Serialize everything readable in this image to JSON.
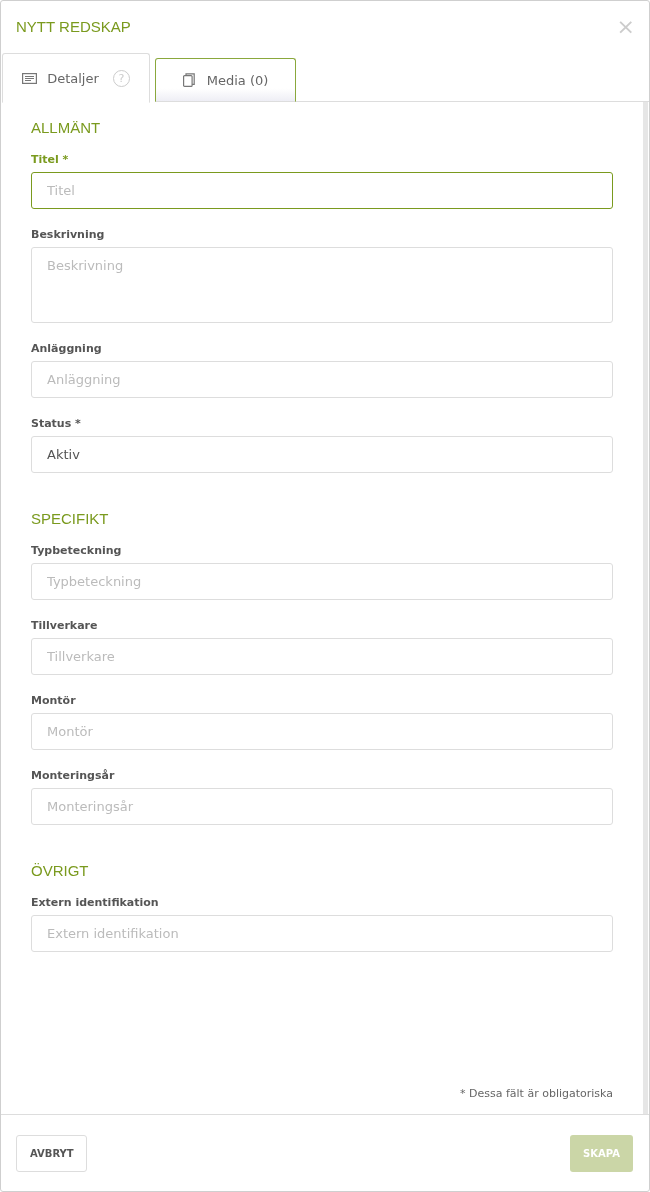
{
  "dialog": {
    "title": "NYTT REDSKAP",
    "close": "×"
  },
  "tabs": [
    {
      "label": "Detaljer",
      "kind": "details",
      "help": "?",
      "selected": true
    },
    {
      "label": "Media (0)",
      "kind": "media",
      "selected": false
    }
  ],
  "sections": [
    {
      "title": "ALLMÄNT",
      "fields": [
        {
          "label": "Titel *",
          "kind": "input",
          "placeholder": "Titel",
          "focused": true
        },
        {
          "label": "Beskrivning",
          "kind": "textarea",
          "placeholder": "Beskrivning",
          "focused": false
        },
        {
          "label": "Anläggning",
          "kind": "input",
          "placeholder": "Anläggning",
          "focused": false
        },
        {
          "label": "Status *",
          "kind": "input",
          "value": "Aktiv",
          "focused": false
        }
      ]
    },
    {
      "title": "SPECIFIKT",
      "fields": [
        {
          "label": "Typbeteckning",
          "kind": "input",
          "placeholder": "Typbeteckning",
          "focused": false
        },
        {
          "label": "Tillverkare",
          "kind": "input",
          "placeholder": "Tillverkare",
          "focused": false
        },
        {
          "label": "Montör",
          "kind": "input",
          "placeholder": "Montör",
          "focused": false
        },
        {
          "label": "Monteringsår",
          "kind": "input",
          "placeholder": "Monteringsår",
          "focused": false
        }
      ]
    },
    {
      "title": "ÖVRIGT",
      "fields": [
        {
          "label": "Extern identifikation",
          "kind": "input",
          "placeholder": "Extern identifikation",
          "focused": false
        }
      ]
    }
  ],
  "required_note": "* Dessa fält är obligatoriska",
  "buttons": [
    {
      "label": "AVBRYT",
      "kind": "cancel",
      "disabled": false
    },
    {
      "label": "SKAPA",
      "kind": "primary",
      "disabled": true
    }
  ]
}
